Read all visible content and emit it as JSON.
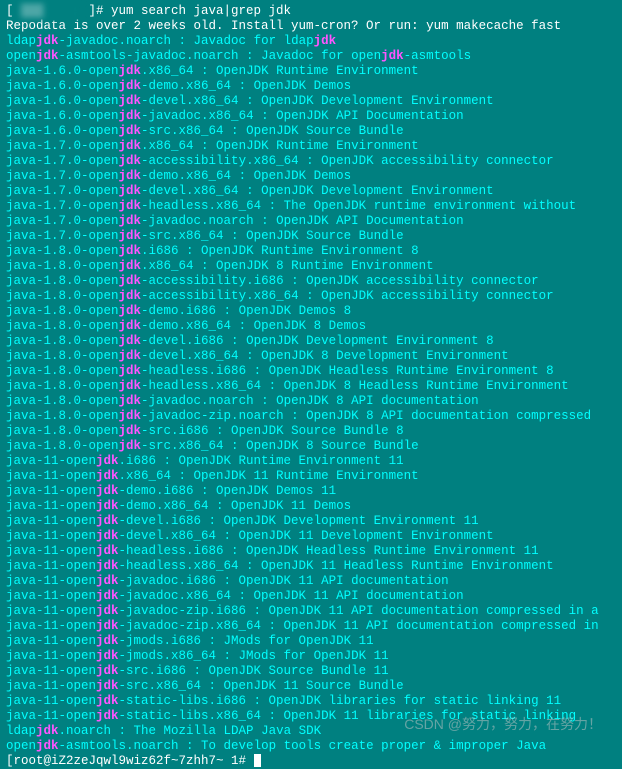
{
  "prompt": {
    "prefix": "[ ",
    "obscured": "██████",
    "suffix": " ]# ",
    "command": "yum search java|grep jdk"
  },
  "repodata": "Repodata is over 2 weeks old. Install yum-cron? Or run: yum makecache fast",
  "lines": [
    {
      "pre": "ldap",
      "hl": "jdk",
      "mid": "-javadoc.noarch : Javadoc for ldap",
      "hl2": "jdk",
      "post": ""
    },
    {
      "pre": "open",
      "hl": "jdk",
      "mid": "-asmtools-javadoc.noarch : Javadoc for open",
      "hl2": "jdk",
      "post": "-asmtools"
    },
    {
      "pre": "java-1.6.0-open",
      "hl": "jdk",
      "mid": ".x86_64 : OpenJDK Runtime Environment",
      "hl2": "",
      "post": ""
    },
    {
      "pre": "java-1.6.0-open",
      "hl": "jdk",
      "mid": "-demo.x86_64 : OpenJDK Demos",
      "hl2": "",
      "post": ""
    },
    {
      "pre": "java-1.6.0-open",
      "hl": "jdk",
      "mid": "-devel.x86_64 : OpenJDK Development Environment",
      "hl2": "",
      "post": ""
    },
    {
      "pre": "java-1.6.0-open",
      "hl": "jdk",
      "mid": "-javadoc.x86_64 : OpenJDK API Documentation",
      "hl2": "",
      "post": ""
    },
    {
      "pre": "java-1.6.0-open",
      "hl": "jdk",
      "mid": "-src.x86_64 : OpenJDK Source Bundle",
      "hl2": "",
      "post": ""
    },
    {
      "pre": "java-1.7.0-open",
      "hl": "jdk",
      "mid": ".x86_64 : OpenJDK Runtime Environment",
      "hl2": "",
      "post": ""
    },
    {
      "pre": "java-1.7.0-open",
      "hl": "jdk",
      "mid": "-accessibility.x86_64 : OpenJDK accessibility connector",
      "hl2": "",
      "post": ""
    },
    {
      "pre": "java-1.7.0-open",
      "hl": "jdk",
      "mid": "-demo.x86_64 : OpenJDK Demos",
      "hl2": "",
      "post": ""
    },
    {
      "pre": "java-1.7.0-open",
      "hl": "jdk",
      "mid": "-devel.x86_64 : OpenJDK Development Environment",
      "hl2": "",
      "post": ""
    },
    {
      "pre": "java-1.7.0-open",
      "hl": "jdk",
      "mid": "-headless.x86_64 : The OpenJDK runtime environment without",
      "hl2": "",
      "post": ""
    },
    {
      "pre": "java-1.7.0-open",
      "hl": "jdk",
      "mid": "-javadoc.noarch : OpenJDK API Documentation",
      "hl2": "",
      "post": ""
    },
    {
      "pre": "java-1.7.0-open",
      "hl": "jdk",
      "mid": "-src.x86_64 : OpenJDK Source Bundle",
      "hl2": "",
      "post": ""
    },
    {
      "pre": "java-1.8.0-open",
      "hl": "jdk",
      "mid": ".i686 : OpenJDK Runtime Environment 8",
      "hl2": "",
      "post": ""
    },
    {
      "pre": "java-1.8.0-open",
      "hl": "jdk",
      "mid": ".x86_64 : OpenJDK 8 Runtime Environment",
      "hl2": "",
      "post": ""
    },
    {
      "pre": "java-1.8.0-open",
      "hl": "jdk",
      "mid": "-accessibility.i686 : OpenJDK accessibility connector",
      "hl2": "",
      "post": ""
    },
    {
      "pre": "java-1.8.0-open",
      "hl": "jdk",
      "mid": "-accessibility.x86_64 : OpenJDK accessibility connector",
      "hl2": "",
      "post": ""
    },
    {
      "pre": "java-1.8.0-open",
      "hl": "jdk",
      "mid": "-demo.i686 : OpenJDK Demos 8",
      "hl2": "",
      "post": ""
    },
    {
      "pre": "java-1.8.0-open",
      "hl": "jdk",
      "mid": "-demo.x86_64 : OpenJDK 8 Demos",
      "hl2": "",
      "post": ""
    },
    {
      "pre": "java-1.8.0-open",
      "hl": "jdk",
      "mid": "-devel.i686 : OpenJDK Development Environment 8",
      "hl2": "",
      "post": ""
    },
    {
      "pre": "java-1.8.0-open",
      "hl": "jdk",
      "mid": "-devel.x86_64 : OpenJDK 8 Development Environment",
      "hl2": "",
      "post": ""
    },
    {
      "pre": "java-1.8.0-open",
      "hl": "jdk",
      "mid": "-headless.i686 : OpenJDK Headless Runtime Environment 8",
      "hl2": "",
      "post": ""
    },
    {
      "pre": "java-1.8.0-open",
      "hl": "jdk",
      "mid": "-headless.x86_64 : OpenJDK 8 Headless Runtime Environment",
      "hl2": "",
      "post": ""
    },
    {
      "pre": "java-1.8.0-open",
      "hl": "jdk",
      "mid": "-javadoc.noarch : OpenJDK 8 API documentation",
      "hl2": "",
      "post": ""
    },
    {
      "pre": "java-1.8.0-open",
      "hl": "jdk",
      "mid": "-javadoc-zip.noarch : OpenJDK 8 API documentation compressed",
      "hl2": "",
      "post": ""
    },
    {
      "pre": "java-1.8.0-open",
      "hl": "jdk",
      "mid": "-src.i686 : OpenJDK Source Bundle 8",
      "hl2": "",
      "post": ""
    },
    {
      "pre": "java-1.8.0-open",
      "hl": "jdk",
      "mid": "-src.x86_64 : OpenJDK 8 Source Bundle",
      "hl2": "",
      "post": ""
    },
    {
      "pre": "java-11-open",
      "hl": "jdk",
      "mid": ".i686 : OpenJDK Runtime Environment 11",
      "hl2": "",
      "post": ""
    },
    {
      "pre": "java-11-open",
      "hl": "jdk",
      "mid": ".x86_64 : OpenJDK 11 Runtime Environment",
      "hl2": "",
      "post": ""
    },
    {
      "pre": "java-11-open",
      "hl": "jdk",
      "mid": "-demo.i686 : OpenJDK Demos 11",
      "hl2": "",
      "post": ""
    },
    {
      "pre": "java-11-open",
      "hl": "jdk",
      "mid": "-demo.x86_64 : OpenJDK 11 Demos",
      "hl2": "",
      "post": ""
    },
    {
      "pre": "java-11-open",
      "hl": "jdk",
      "mid": "-devel.i686 : OpenJDK Development Environment 11",
      "hl2": "",
      "post": ""
    },
    {
      "pre": "java-11-open",
      "hl": "jdk",
      "mid": "-devel.x86_64 : OpenJDK 11 Development Environment",
      "hl2": "",
      "post": ""
    },
    {
      "pre": "java-11-open",
      "hl": "jdk",
      "mid": "-headless.i686 : OpenJDK Headless Runtime Environment 11",
      "hl2": "",
      "post": ""
    },
    {
      "pre": "java-11-open",
      "hl": "jdk",
      "mid": "-headless.x86_64 : OpenJDK 11 Headless Runtime Environment",
      "hl2": "",
      "post": ""
    },
    {
      "pre": "java-11-open",
      "hl": "jdk",
      "mid": "-javadoc.i686 : OpenJDK 11 API documentation",
      "hl2": "",
      "post": ""
    },
    {
      "pre": "java-11-open",
      "hl": "jdk",
      "mid": "-javadoc.x86_64 : OpenJDK 11 API documentation",
      "hl2": "",
      "post": ""
    },
    {
      "pre": "java-11-open",
      "hl": "jdk",
      "mid": "-javadoc-zip.i686 : OpenJDK 11 API documentation compressed in a",
      "hl2": "",
      "post": ""
    },
    {
      "pre": "java-11-open",
      "hl": "jdk",
      "mid": "-javadoc-zip.x86_64 : OpenJDK 11 API documentation compressed in",
      "hl2": "",
      "post": ""
    },
    {
      "pre": "java-11-open",
      "hl": "jdk",
      "mid": "-jmods.i686 : JMods for OpenJDK 11",
      "hl2": "",
      "post": ""
    },
    {
      "pre": "java-11-open",
      "hl": "jdk",
      "mid": "-jmods.x86_64 : JMods for OpenJDK 11",
      "hl2": "",
      "post": ""
    },
    {
      "pre": "java-11-open",
      "hl": "jdk",
      "mid": "-src.i686 : OpenJDK Source Bundle 11",
      "hl2": "",
      "post": ""
    },
    {
      "pre": "java-11-open",
      "hl": "jdk",
      "mid": "-src.x86_64 : OpenJDK 11 Source Bundle",
      "hl2": "",
      "post": ""
    },
    {
      "pre": "java-11-open",
      "hl": "jdk",
      "mid": "-static-libs.i686 : OpenJDK libraries for static linking 11",
      "hl2": "",
      "post": ""
    },
    {
      "pre": "java-11-open",
      "hl": "jdk",
      "mid": "-static-libs.x86_64 : OpenJDK 11 libraries for static linking",
      "hl2": "",
      "post": ""
    },
    {
      "pre": "ldap",
      "hl": "jdk",
      "mid": ".noarch : The Mozilla LDAP Java SDK",
      "hl2": "",
      "post": ""
    },
    {
      "pre": "open",
      "hl": "jdk",
      "mid": "-asmtools.noarch : To develop tools create proper & improper Java",
      "hl2": "",
      "post": ""
    }
  ],
  "lastprompt": {
    "prefix": "[root@iZ2zeJqwl9wiz62f~7zhh7~ 1# "
  },
  "watermark": "CSDN @努力，努力，在努力！"
}
